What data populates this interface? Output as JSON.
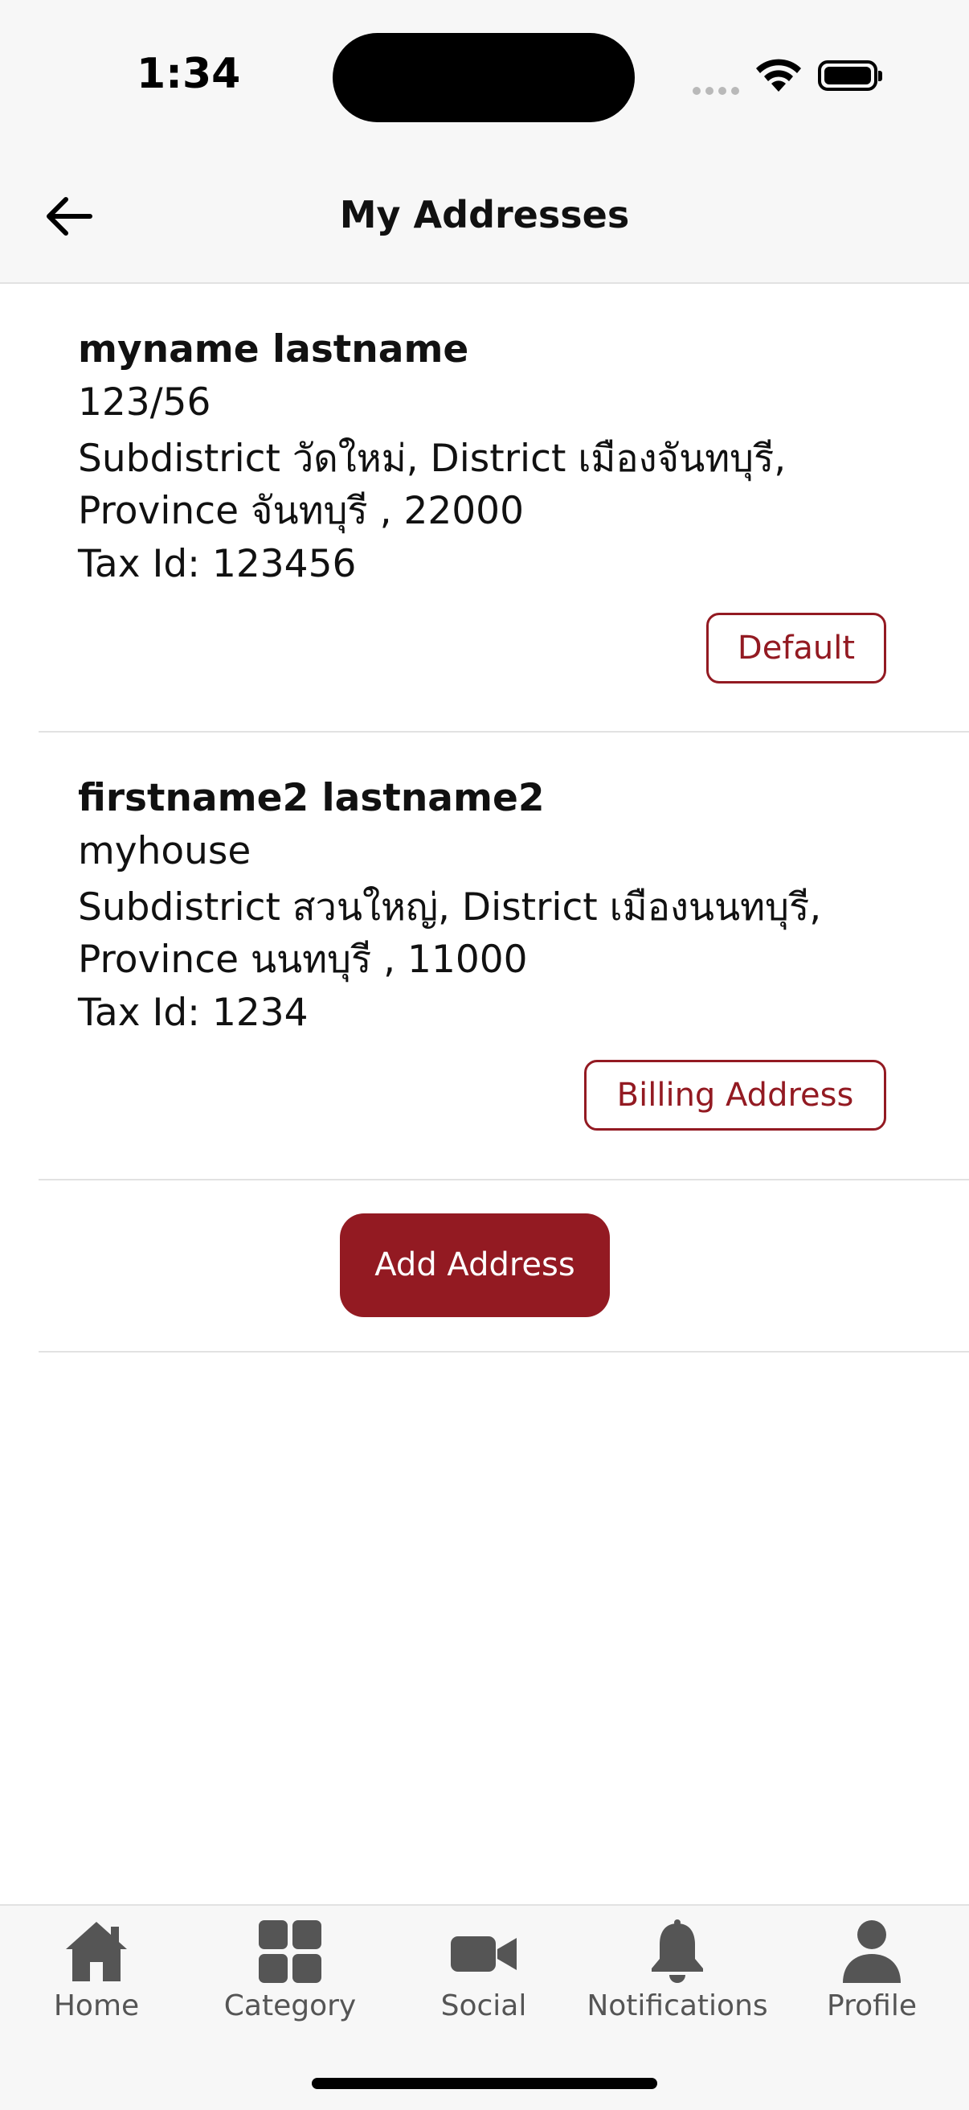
{
  "status_bar": {
    "time": "1:34"
  },
  "header": {
    "title": "My Addresses"
  },
  "addresses": [
    {
      "name": "myname lastname",
      "line1": "123/56",
      "line2": "Subdistrict วัดใหม่, District เมืองจันทบุรี,",
      "line3": "Province จันทบุรี , 22000",
      "tax": "Tax Id: 123456",
      "badge": "Default"
    },
    {
      "name": "firstname2 lastname2",
      "line1": "myhouse",
      "line2": "Subdistrict สวนใหญ่, District เมืองนนทบุรี,",
      "line3": "Province นนทบุรี , 11000",
      "tax": "Tax Id: 1234",
      "badge": "Billing Address"
    }
  ],
  "add_button": "Add Address",
  "tabs": [
    {
      "label": "Home",
      "icon": "home-icon"
    },
    {
      "label": "Category",
      "icon": "grid-icon"
    },
    {
      "label": "Social",
      "icon": "video-icon"
    },
    {
      "label": "Notifications",
      "icon": "bell-icon"
    },
    {
      "label": "Profile",
      "icon": "person-icon"
    }
  ],
  "colors": {
    "accent": "#931a22",
    "bar_background": "#f7f7f7",
    "tab_icon": "#555555"
  }
}
